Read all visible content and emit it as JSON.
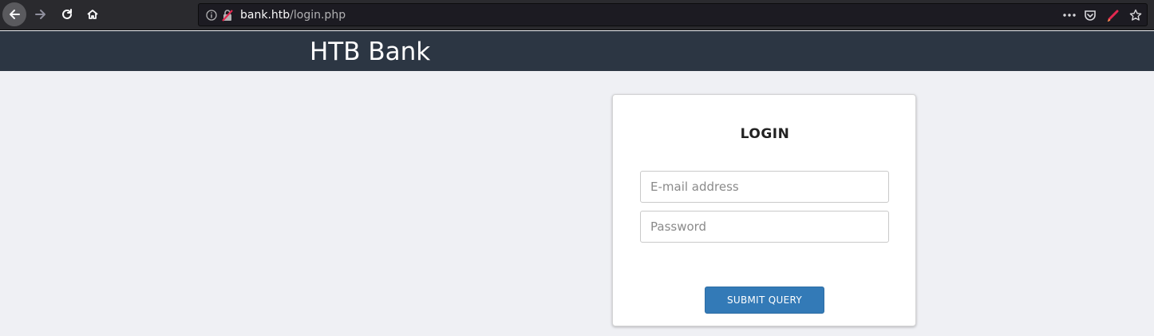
{
  "browser": {
    "url_host": "bank.htb",
    "url_path": "/login.php"
  },
  "header": {
    "title": "HTB Bank"
  },
  "login": {
    "title": "LOGIN",
    "email_placeholder": "E-mail address",
    "password_placeholder": "Password",
    "submit_label": "SUBMIT QUERY"
  },
  "colors": {
    "header_bg": "#2c3643",
    "page_bg": "#eff0f4",
    "button_bg": "#337ab7"
  },
  "icons": [
    "back-arrow-icon",
    "forward-arrow-icon",
    "reload-icon",
    "home-icon",
    "info-icon",
    "insecure-lock-icon",
    "more-icon",
    "pocket-icon",
    "pen-icon",
    "star-icon"
  ]
}
